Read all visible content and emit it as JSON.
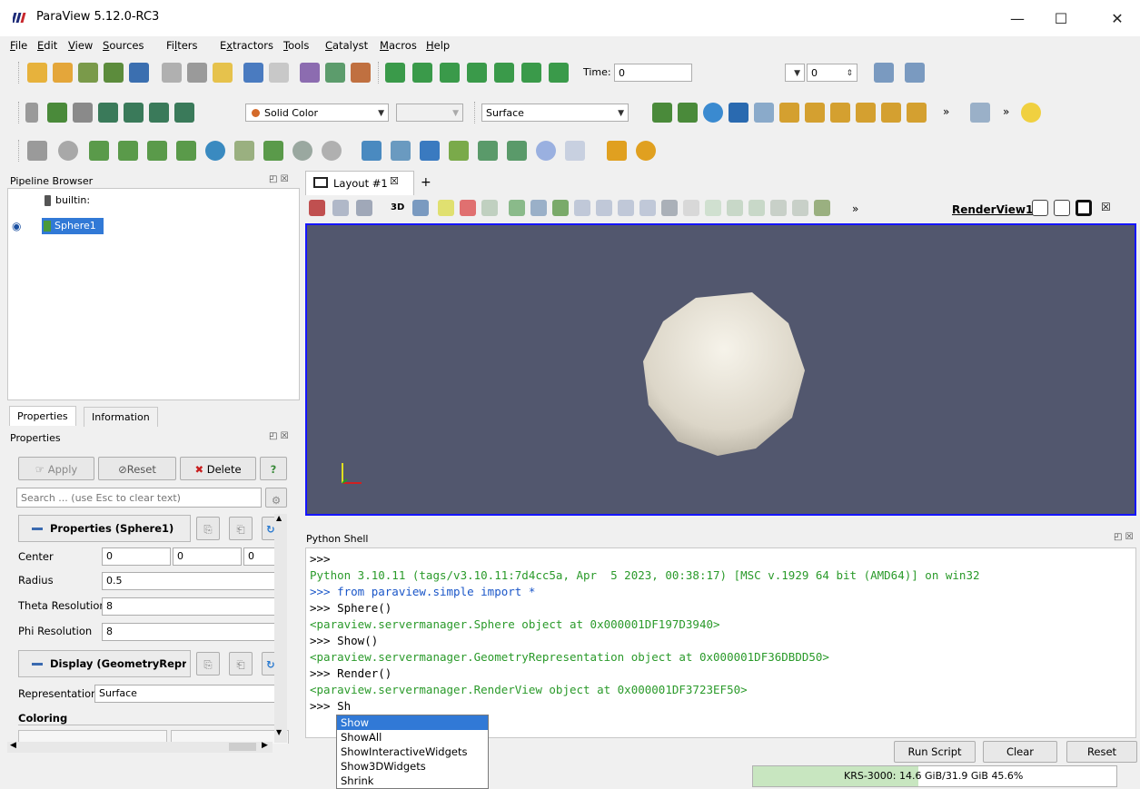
{
  "window": {
    "title": "ParaView 5.12.0-RC3",
    "minimize": "—",
    "maximize": "☐",
    "close": "✕"
  },
  "menubar": {
    "items": [
      {
        "pre": "",
        "u": "F",
        "post": "ile"
      },
      {
        "pre": "",
        "u": "E",
        "post": "dit"
      },
      {
        "pre": "",
        "u": "V",
        "post": "iew"
      },
      {
        "pre": "",
        "u": "S",
        "post": "ources"
      },
      {
        "pre": "Fi",
        "u": "l",
        "post": "ters"
      },
      {
        "pre": "E",
        "u": "x",
        "post": "tractors"
      },
      {
        "pre": "",
        "u": "T",
        "post": "ools"
      },
      {
        "pre": "",
        "u": "C",
        "post": "atalyst"
      },
      {
        "pre": "",
        "u": "M",
        "post": "acros"
      },
      {
        "pre": "",
        "u": "H",
        "post": "elp"
      }
    ]
  },
  "toolbar_time": {
    "label": "Time:",
    "time_value": "0",
    "index_value": "0"
  },
  "toolbar_display": {
    "color_by": "Solid Color",
    "component": "",
    "representation": "Surface"
  },
  "pipeline": {
    "title": "Pipeline Browser",
    "items": [
      {
        "label": "builtin:"
      },
      {
        "label": "Sphere1"
      }
    ]
  },
  "tabs": {
    "properties": "Properties",
    "information": "Information"
  },
  "properties": {
    "title": "Properties",
    "apply": "Apply",
    "reset": "Reset",
    "delete": "Delete",
    "help": "?",
    "search_placeholder": "Search ... (use Esc to clear text)",
    "section1": "Properties (Sphere1)",
    "center_label": "Center",
    "center": [
      "0",
      "0",
      "0"
    ],
    "radius_label": "Radius",
    "radius": "0.5",
    "theta_label": "Theta Resolution",
    "theta": "8",
    "phi_label": "Phi Resolution",
    "phi": "8",
    "section2": "Display (GeometryRepr",
    "representation_label": "Representation",
    "representation": "Surface",
    "coloring_label": "Coloring"
  },
  "layout": {
    "tab_label": "Layout #1",
    "add_tab": "+",
    "view_name": "RenderView1",
    "toolbar_3d": "3D",
    "more": "»"
  },
  "shell": {
    "title": "Python Shell",
    "lines": [
      {
        "text": ">>> ",
        "cls": ""
      },
      {
        "text": "Python 3.10.11 (tags/v3.10.11:7d4cc5a, Apr  5 2023, 00:38:17) [MSC v.1929 64 bit (AMD64)] on win32",
        "cls": "green"
      },
      {
        "text": ">>> from paraview.simple import *",
        "cls": "blue"
      },
      {
        "text": ">>> Sphere()",
        "cls": ""
      },
      {
        "text": "<paraview.servermanager.Sphere object at 0x000001DF197D3940>",
        "cls": "green"
      },
      {
        "text": ">>> Show()",
        "cls": ""
      },
      {
        "text": "<paraview.servermanager.GeometryRepresentation object at 0x000001DF36DBDD50>",
        "cls": "green"
      },
      {
        "text": ">>> Render()",
        "cls": ""
      },
      {
        "text": "<paraview.servermanager.RenderView object at 0x000001DF3723EF50>",
        "cls": "green"
      },
      {
        "text": ">>> Sh",
        "cls": ""
      }
    ],
    "autocomplete": [
      "Show",
      "ShowAll",
      "ShowInteractiveWidgets",
      "Show3DWidgets",
      "Shrink"
    ],
    "run_script": "Run Script",
    "clear": "Clear",
    "reset": "Reset"
  },
  "memory": {
    "text": "KRS-3000: 14.6 GiB/31.9 GiB 45.6%",
    "percent": 45.6
  },
  "colors": {
    "render_bg": "#52576e",
    "view_border": "#1515ff",
    "selection": "#3179d6",
    "memory_bar": "#c8e6c0"
  }
}
